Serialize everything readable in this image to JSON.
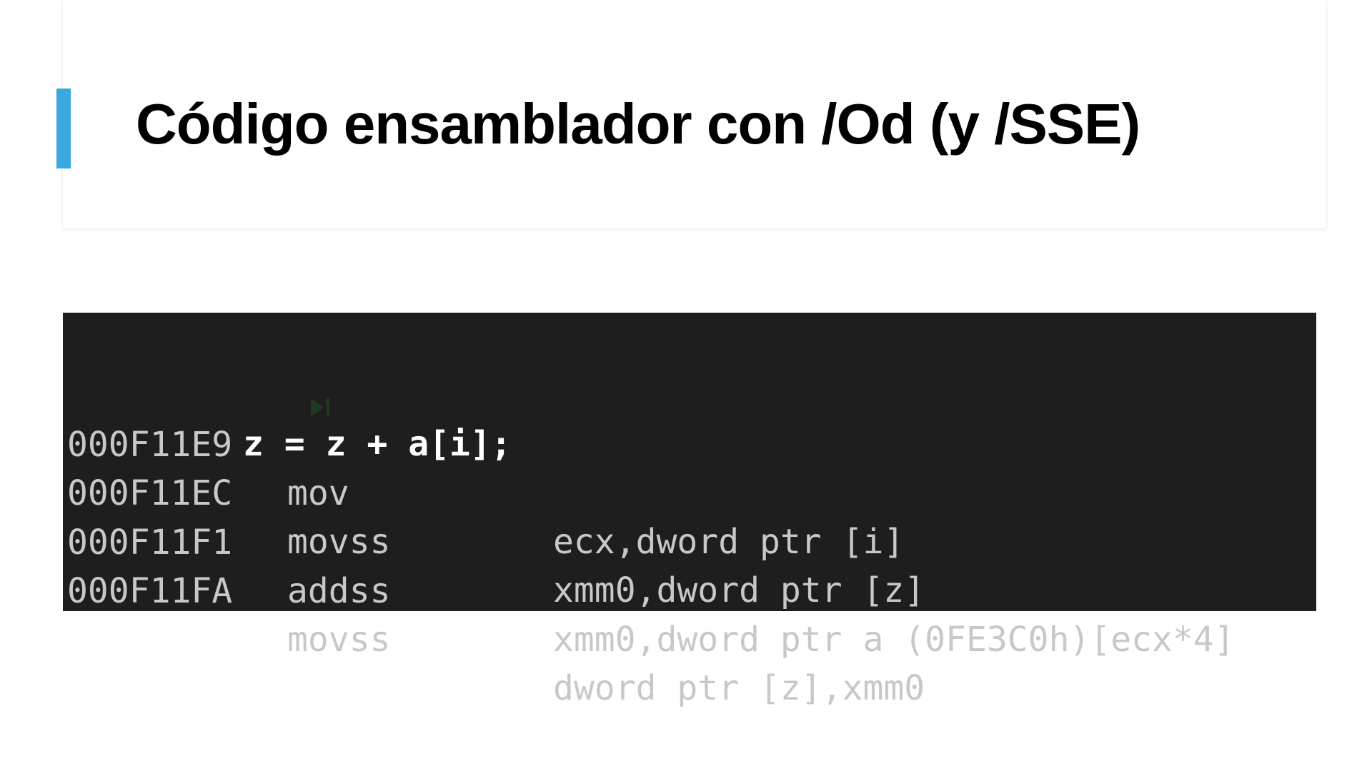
{
  "colors": {
    "accent": "#3aa9df",
    "code_background": "#1e1e1e",
    "source_text": "#ffffff",
    "disassembly_text": "#c8c8c8",
    "breakpoint_marker": "#1f3a1f"
  },
  "slide": {
    "title": "Código ensamblador con /Od (y /SSE)"
  },
  "code": {
    "source_statement": "z = z + a[i];",
    "current_line_marker_icon": "step-arrow-icon",
    "instructions": [
      {
        "address": "000F11E9",
        "opcode": "mov",
        "operands": "ecx,dword ptr [i]"
      },
      {
        "address": "000F11EC",
        "opcode": "movss",
        "operands": "xmm0,dword ptr [z]"
      },
      {
        "address": "000F11F1",
        "opcode": "addss",
        "operands": "xmm0,dword ptr a (0FE3C0h)[ecx*4]"
      },
      {
        "address": "000F11FA",
        "opcode": "movss",
        "operands": "dword ptr [z],xmm0"
      }
    ],
    "closing_brace": "}"
  }
}
